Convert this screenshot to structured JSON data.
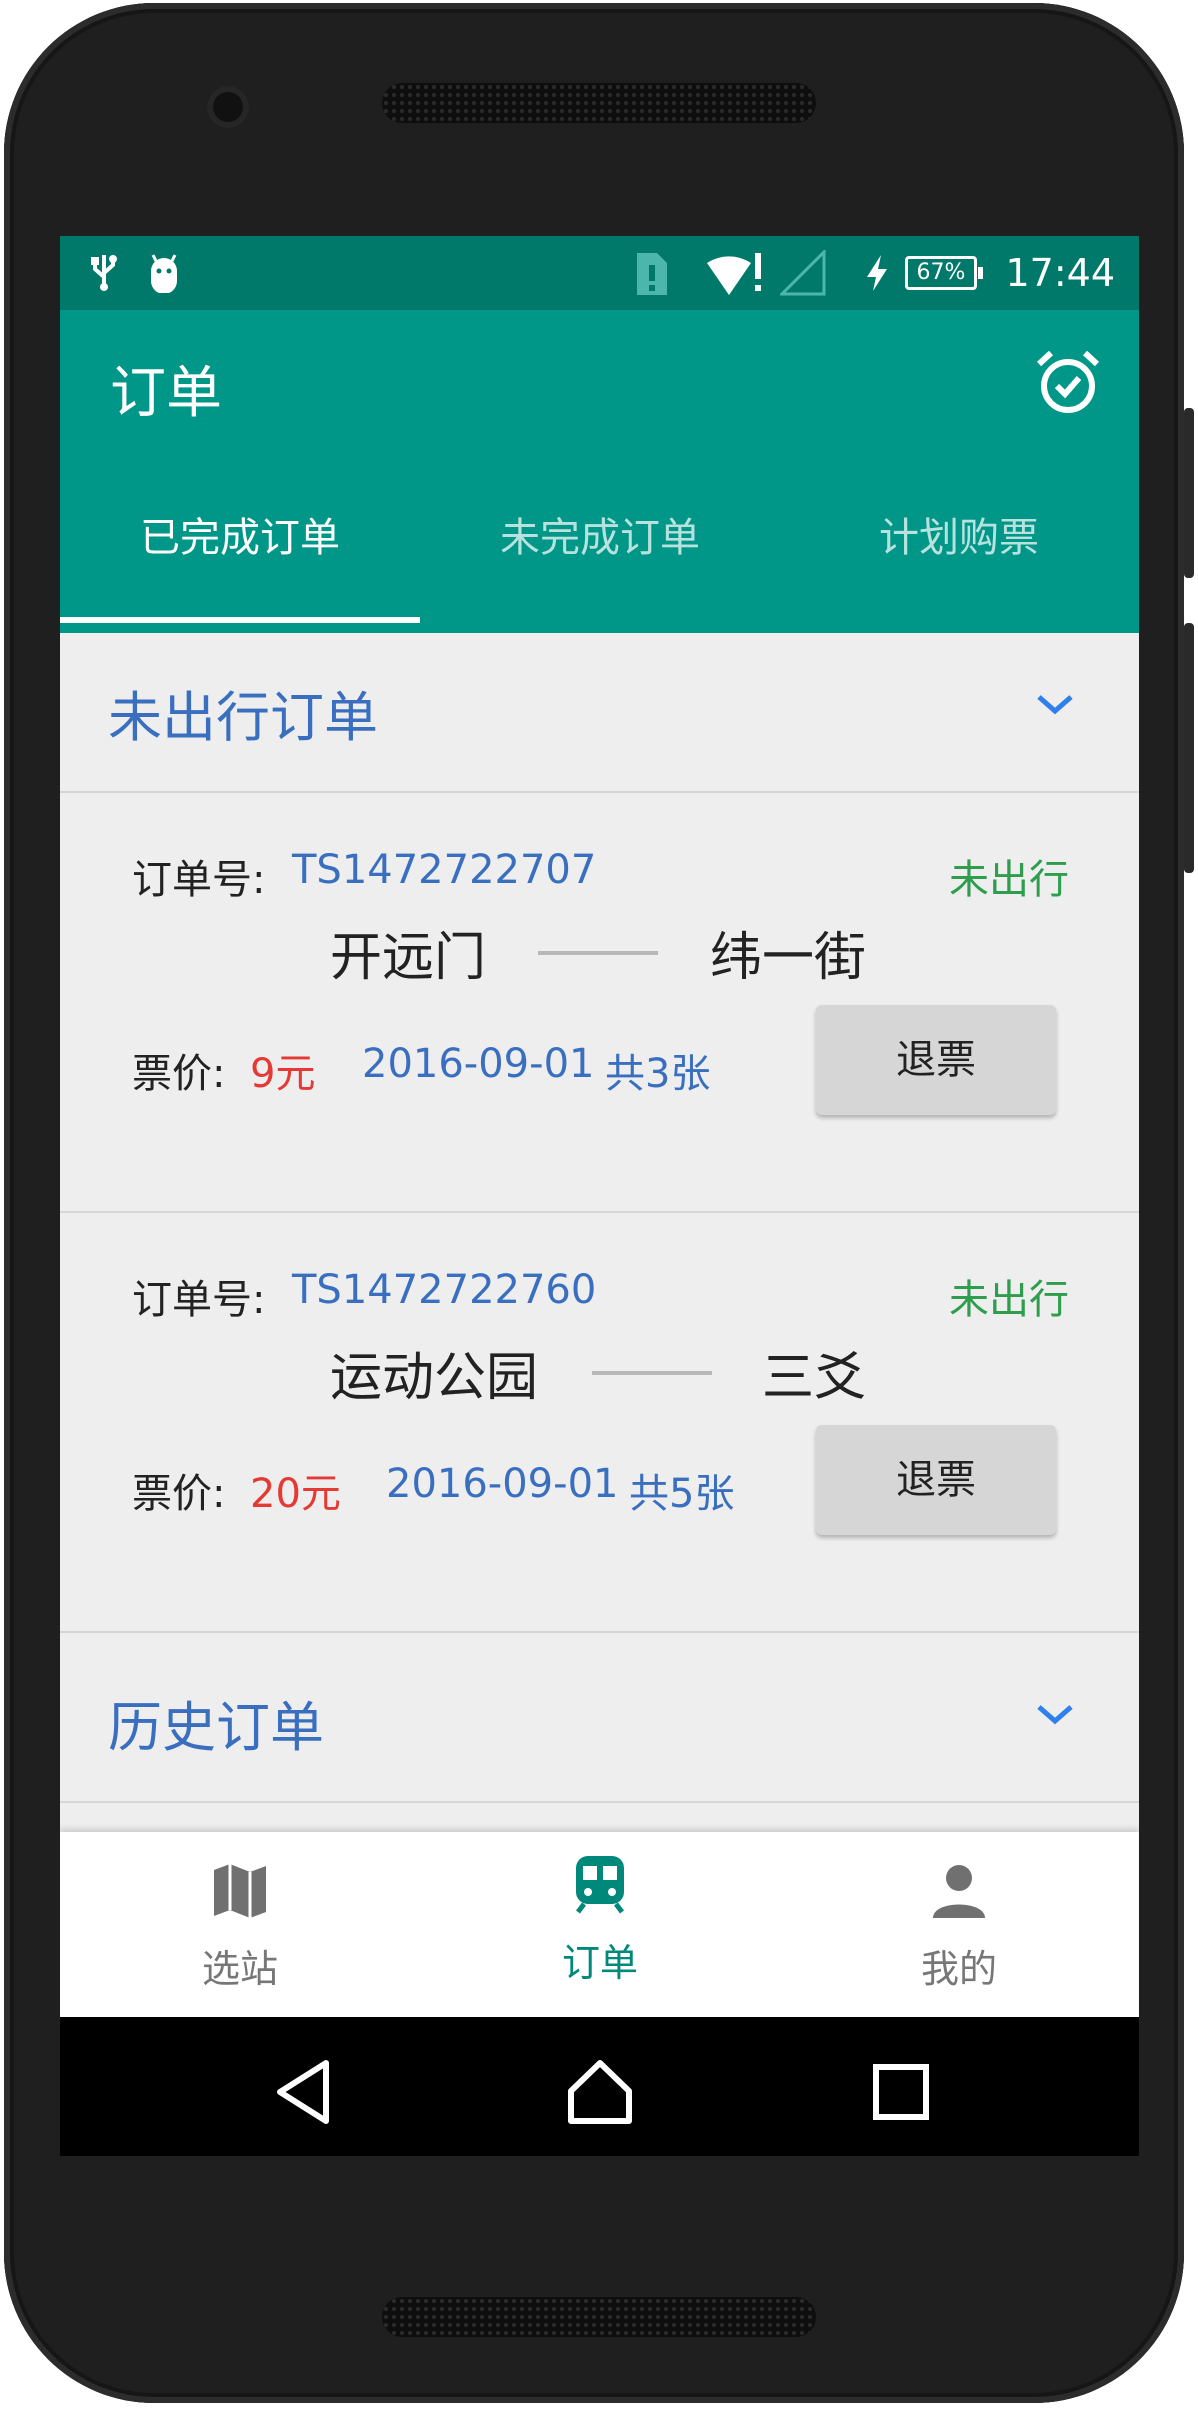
{
  "status_bar": {
    "time": "17:44",
    "battery": "67%",
    "icons": [
      "usb-icon",
      "android-debug-icon",
      "sim-alert-icon",
      "wifi-icon",
      "signal-icon",
      "charging-icon",
      "battery-icon"
    ]
  },
  "app_bar": {
    "title": "订单",
    "action_icon": "alarm-check-icon"
  },
  "tabs": [
    {
      "label": "已完成订单",
      "active": true
    },
    {
      "label": "未完成订单",
      "active": false
    },
    {
      "label": "计划购票",
      "active": false
    }
  ],
  "sections": {
    "upcoming": {
      "title": "未出行订单"
    },
    "history": {
      "title": "历史订单"
    }
  },
  "orders": [
    {
      "order_label": "订单号:",
      "order_number": "TS1472722707",
      "status": "未出行",
      "from": "开远门",
      "to": "纬一街",
      "price_label": "票价:",
      "price": "9元",
      "date": "2016-09-01",
      "count": "共3张",
      "refund_label": "退票"
    },
    {
      "order_label": "订单号:",
      "order_number": "TS1472722760",
      "status": "未出行",
      "from": "运动公园",
      "to": "三爻",
      "price_label": "票价:",
      "price": "20元",
      "date": "2016-09-01",
      "count": "共5张",
      "refund_label": "退票"
    }
  ],
  "bottom_nav": [
    {
      "label": "选站",
      "icon": "map-icon",
      "active": false
    },
    {
      "label": "订单",
      "icon": "train-icon",
      "active": true
    },
    {
      "label": "我的",
      "icon": "person-icon",
      "active": false
    }
  ],
  "colors": {
    "primary": "#009688",
    "primary_dark": "#00796b",
    "link_blue": "#3a6fc0",
    "status_green": "#2e9e4e",
    "price_red": "#e53935"
  }
}
